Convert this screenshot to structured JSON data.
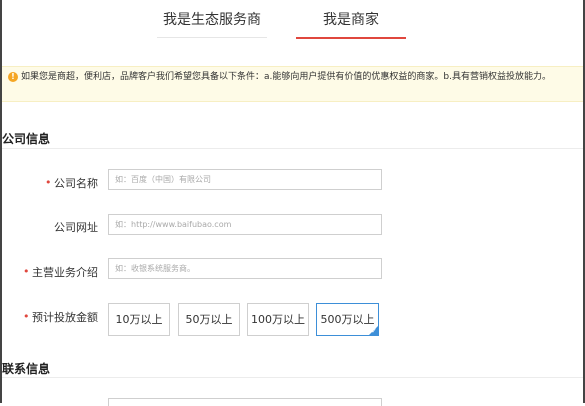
{
  "tabs": [
    {
      "label": "我是生态服务商",
      "active": false
    },
    {
      "label": "我是商家",
      "active": true
    }
  ],
  "notice": {
    "text": "如果您是商超，便利店，品牌客户我们希望您具备以下条件：a.能够向用户提供有价值的优惠权益的商家。b.具有营销权益投放能力。"
  },
  "sections": {
    "company": "公司信息",
    "contact": "联系信息"
  },
  "fields": {
    "company_name": {
      "label": "公司名称",
      "required": true,
      "placeholder": "如：百度（中国）有限公司"
    },
    "company_url": {
      "label": "公司网址",
      "required": false,
      "placeholder": "如：http://www.baifubao.com"
    },
    "main_business": {
      "label": "主营业务介绍",
      "required": true,
      "placeholder": "如：收银系统服务商。"
    },
    "budget": {
      "label": "预计投放金额",
      "required": true
    }
  },
  "required_mark": "•",
  "budget_options": [
    {
      "label": "10万以上",
      "selected": false
    },
    {
      "label": "50万以上",
      "selected": false
    },
    {
      "label": "100万以上",
      "selected": false
    },
    {
      "label": "500万以上",
      "selected": true
    }
  ],
  "colors": {
    "accent_red": "#e0473e",
    "selected_blue": "#3d8fd8",
    "notice_bg": "#fefbe7",
    "notice_icon": "#f5a623"
  }
}
